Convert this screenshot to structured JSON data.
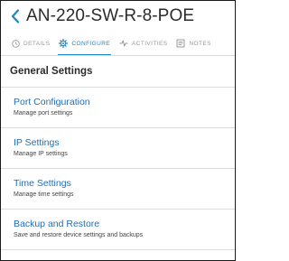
{
  "header": {
    "back_icon": "chevron-left-icon",
    "title": "AN-220-SW-R-8-POE"
  },
  "tabs": [
    {
      "label": "DETAILS",
      "icon": "clock-icon",
      "active": false
    },
    {
      "label": "CONFIGURE",
      "icon": "gear-icon",
      "active": true
    },
    {
      "label": "ACTIVITIES",
      "icon": "activity-icon",
      "active": false
    },
    {
      "label": "NOTES",
      "icon": "notes-icon",
      "active": false
    }
  ],
  "colors": {
    "accent": "#1f86c8",
    "link": "#1f6fb5",
    "muted": "#9a9a9a",
    "divider": "#dcdcdc"
  },
  "section": {
    "title": "General Settings"
  },
  "items": [
    {
      "title": "Port Configuration",
      "subtitle": "Manage port settings"
    },
    {
      "title": "IP Settings",
      "subtitle": "Manage IP settings"
    },
    {
      "title": "Time Settings",
      "subtitle": "Manage time settings"
    },
    {
      "title": "Backup and Restore",
      "subtitle": "Save and restore device settings and backups"
    }
  ]
}
